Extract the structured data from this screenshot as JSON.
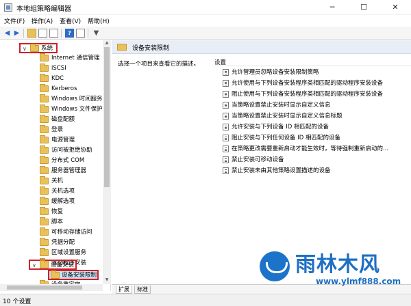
{
  "window": {
    "title": "本地组策略编辑器",
    "minimize_icon": "minimize-icon",
    "maximize_icon": "maximize-icon",
    "close_icon": "close-icon"
  },
  "menu": {
    "file": "文件(F)",
    "action": "操作(A)",
    "view": "查看(V)",
    "help": "帮助(H)"
  },
  "toolbar": {
    "icons": [
      "back-arrow-icon",
      "forward-arrow-icon",
      "up-folder-icon",
      "show-hide-tree-icon",
      "export-list-icon",
      "help-icon",
      "properties-icon",
      "filter-icon"
    ]
  },
  "tree": {
    "items": [
      {
        "label": "系统",
        "expanded": true
      },
      {
        "label": "Internet 通信管理"
      },
      {
        "label": "iSCSI"
      },
      {
        "label": "KDC"
      },
      {
        "label": "Kerberos"
      },
      {
        "label": "Windows 时间服务"
      },
      {
        "label": "Windows 文件保护"
      },
      {
        "label": "磁盘配额"
      },
      {
        "label": "登录"
      },
      {
        "label": "电源管理"
      },
      {
        "label": "访问被拒绝协助"
      },
      {
        "label": "分布式 COM"
      },
      {
        "label": "服务器管理器"
      },
      {
        "label": "关机"
      },
      {
        "label": "关机选项"
      },
      {
        "label": "缓解选项"
      },
      {
        "label": "恢复"
      },
      {
        "label": "脚本"
      },
      {
        "label": "可移动存储访问"
      },
      {
        "label": "凭据分配"
      },
      {
        "label": "区域设置服务"
      },
      {
        "label": "驱动程序安装"
      },
      {
        "label": "设备安装",
        "expanded": true
      },
      {
        "label": "设备安装限制",
        "selected": true
      },
      {
        "label": "设备重定向"
      }
    ]
  },
  "right": {
    "header_title": "设备安装限制",
    "hint": "选择一个项目来查看它的描述。",
    "column_header": "设置",
    "settings": [
      "允许管理员忽略设备安装限制策略",
      "允许使用与下列设备安装程序类相匹配的驱动程序安装设备",
      "阻止使用与下列设备安装程序类相匹配的驱动程序安装设备",
      "当策略设置禁止安装时显示自定义信息",
      "当策略设置禁止安装时显示自定义信息标题",
      "允许安装与下列设备 ID 相匹配的设备",
      "阻止安装与下列任何设备 ID 相匹配的设备",
      "在策略更改需要重新启动才能生效时，等待强制重新启动的...",
      "禁止安装可移动设备",
      "禁止安装未由其他策略设置描述的设备"
    ],
    "tabs": [
      "扩展",
      "标准"
    ]
  },
  "status": {
    "text": "10 个设置"
  },
  "watermark": {
    "brand": "雨林木风",
    "url": "www.ylmf888.com"
  }
}
